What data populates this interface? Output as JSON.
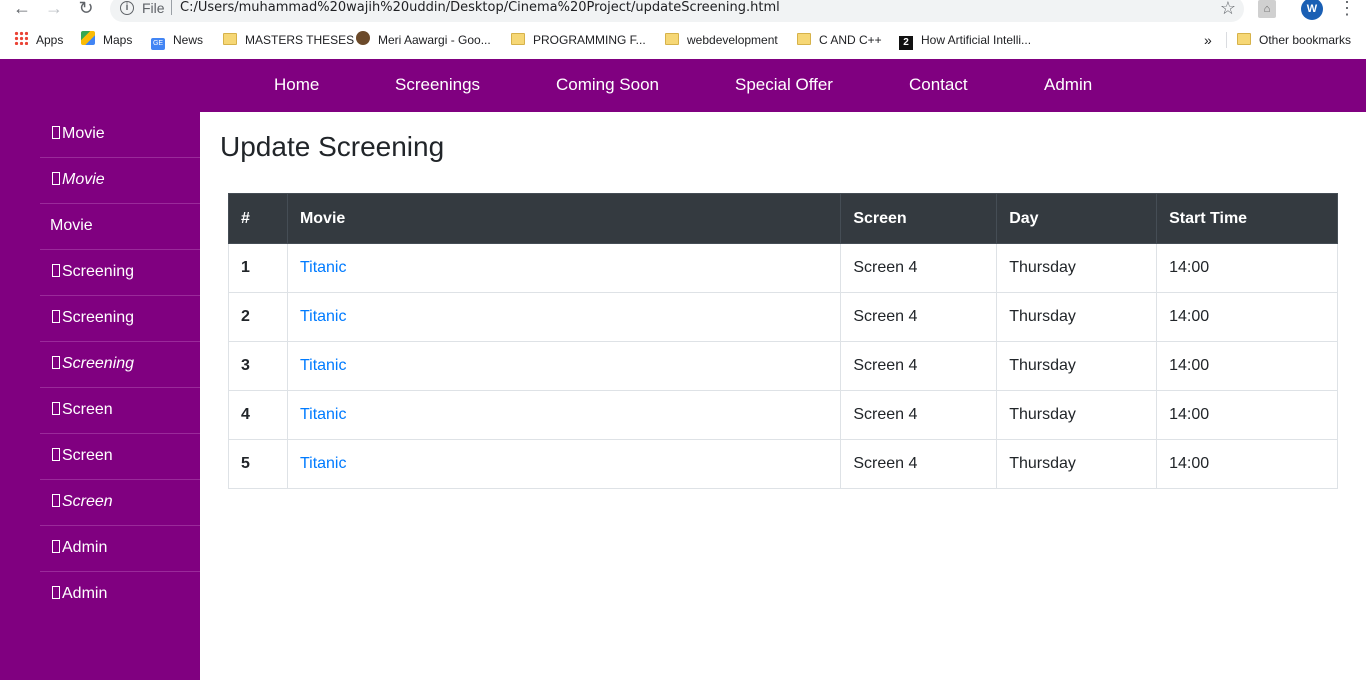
{
  "browser": {
    "file_label": "File",
    "url": "C:/Users/muhammad%20wajih%20uddin/Desktop/Cinema%20Project/updateScreening.html",
    "avatar_letter": "W",
    "bookmarks": [
      {
        "label": "Apps",
        "icon": "apps-grid-icon"
      },
      {
        "label": "Maps",
        "icon": "maps-icon"
      },
      {
        "label": "News",
        "icon": "news-icon"
      },
      {
        "label": "MASTERS THESES",
        "icon": "folder-icon"
      },
      {
        "label": "Meri Aawargi - Goo...",
        "icon": "meri-aawargi-icon"
      },
      {
        "label": "PROGRAMMING F...",
        "icon": "folder-icon"
      },
      {
        "label": "webdevelopment",
        "icon": "folder-icon"
      },
      {
        "label": "C AND C++",
        "icon": "folder-icon"
      },
      {
        "label": "How Artificial Intelli...",
        "icon": "quora-icon"
      }
    ],
    "overflow": "»",
    "other_bookmarks": "Other bookmarks"
  },
  "site": {
    "brand_color": "#800080",
    "nav": [
      "Home",
      "Screenings",
      "Coming Soon",
      "Special Offer",
      "Contact",
      "Admin"
    ],
    "sidebar": [
      {
        "label": "Movie",
        "glyph": true,
        "italic": false
      },
      {
        "label": "Movie",
        "glyph": true,
        "italic": true
      },
      {
        "label": "Movie",
        "glyph": false,
        "italic": false
      },
      {
        "label": "Screening",
        "glyph": true,
        "italic": false
      },
      {
        "label": "Screening",
        "glyph": true,
        "italic": false
      },
      {
        "label": "Screening",
        "glyph": true,
        "italic": true
      },
      {
        "label": "Screen",
        "glyph": true,
        "italic": false
      },
      {
        "label": "Screen",
        "glyph": true,
        "italic": false
      },
      {
        "label": "Screen",
        "glyph": true,
        "italic": true
      },
      {
        "label": "Admin",
        "glyph": true,
        "italic": false
      },
      {
        "label": "Admin",
        "glyph": true,
        "italic": false
      }
    ],
    "page_title": "Update Screening",
    "table": {
      "headers": [
        "#",
        "Movie",
        "Screen",
        "Day",
        "Start Time"
      ],
      "rows": [
        {
          "num": "1",
          "movie": "Titanic",
          "screen": "Screen 4",
          "day": "Thursday",
          "time": "14:00"
        },
        {
          "num": "2",
          "movie": "Titanic",
          "screen": "Screen 4",
          "day": "Thursday",
          "time": "14:00"
        },
        {
          "num": "3",
          "movie": "Titanic",
          "screen": "Screen 4",
          "day": "Thursday",
          "time": "14:00"
        },
        {
          "num": "4",
          "movie": "Titanic",
          "screen": "Screen 4",
          "day": "Thursday",
          "time": "14:00"
        },
        {
          "num": "5",
          "movie": "Titanic",
          "screen": "Screen 4",
          "day": "Thursday",
          "time": "14:00"
        }
      ]
    }
  }
}
